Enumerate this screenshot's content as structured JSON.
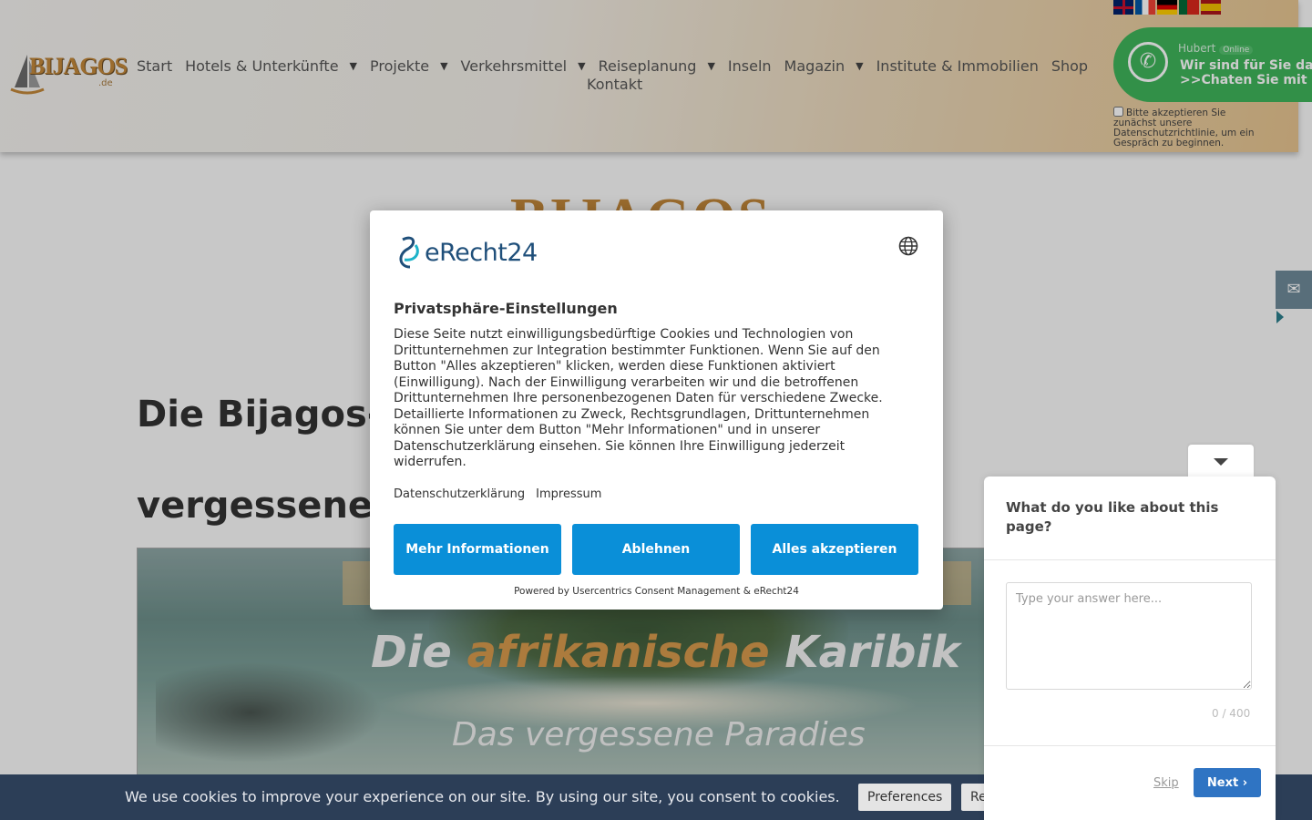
{
  "header": {
    "logo_text": "BIJAGOS",
    "logo_suffix": ".de",
    "nav": [
      {
        "label": "Start",
        "has_dropdown": false
      },
      {
        "label": "Hotels & Unterkünfte",
        "has_dropdown": true
      },
      {
        "label": "Projekte",
        "has_dropdown": true
      },
      {
        "label": "Verkehrsmittel",
        "has_dropdown": true
      },
      {
        "label": "Reiseplanung",
        "has_dropdown": true
      },
      {
        "label": "Inseln",
        "has_dropdown": false
      },
      {
        "label": "Magazin",
        "has_dropdown": true
      },
      {
        "label": "Institute & Immobilien",
        "has_dropdown": false
      },
      {
        "label": "Shop",
        "has_dropdown": false
      },
      {
        "label": "Kontakt",
        "has_dropdown": false
      }
    ],
    "flags": [
      "english-flag",
      "french-flag",
      "german-flag",
      "portuguese-flag",
      "spanish-flag"
    ],
    "whatsapp": {
      "name": "Hubert",
      "status": "Online",
      "line1": "Wir sind für Sie da",
      "line2": ">>Chaten Sie mit",
      "consent": "Bitte akzeptieren Sie zunächst unsere Datenschutzrichtlinie, um ein Gespräch zu beginnen."
    }
  },
  "page": {
    "big_logo": "BIJAGOS",
    "title": "Die Bijagos-Inseln - Ein afrikanisches vergessenes Paradies",
    "hero_title_pre": "Die ",
    "hero_title_accent": "afrikanische",
    "hero_title_post": " Karibik",
    "hero_subtitle": "Das vergessene Paradies"
  },
  "consent_modal": {
    "brand": "eRecht24",
    "title": "Privatsphäre-Einstellungen",
    "body": "Diese Seite nutzt einwilligungsbedürftige Cookies und Technologien von Drittunternehmen zur Integration bestimmter Funktionen. Wenn Sie auf den Button \"Alles akzeptieren\" klicken, werden diese Funktionen aktiviert (Einwilligung). Nach der Einwilligung verarbeiten wir und die betroffenen Drittunternehmen Ihre personenbezogenen Daten für verschiedene Zwecke. Detaillierte Informationen zu Zweck, Rechtsgrundlagen, Drittunternehmen können Sie unter dem Button \"Mehr Informationen\" und in unserer Datenschutzerklärung einsehen. Sie können Ihre Einwilligung jederzeit widerrufen.",
    "link_privacy": "Datenschutzerklärung",
    "link_imprint": "Impressum",
    "btn_more": "Mehr Informationen",
    "btn_decline": "Ablehnen",
    "btn_accept": "Alles akzeptieren",
    "powered_by": "Powered by Usercentrics Consent Management & eRecht24",
    "accent_color": "#0a8fd8"
  },
  "feedback": {
    "question": "What do you like about this page?",
    "placeholder": "Type your answer here...",
    "counter": "0 / 400",
    "skip": "Skip",
    "next": "Next"
  },
  "cookie_bar": {
    "text": "We use cookies to improve your experience on our site. By using our site, you consent to cookies.",
    "btn_preferences": "Preferences",
    "btn_reject": "Re"
  },
  "colors": {
    "brand_orange": "#c2873a",
    "whatsapp_green": "#3fb55a",
    "cookie_bar_bg": "#2c3e57"
  }
}
